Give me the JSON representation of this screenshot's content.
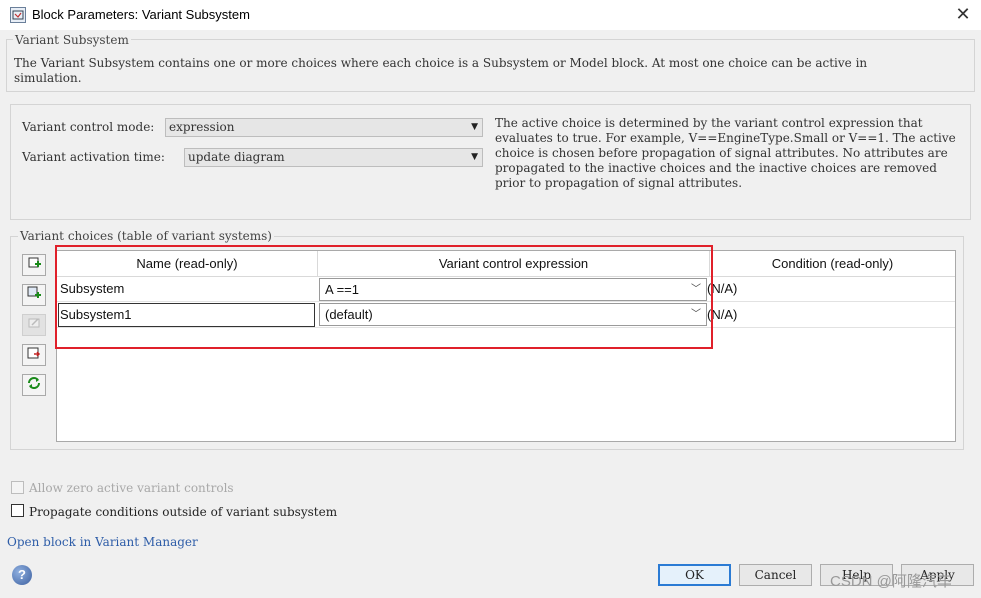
{
  "window": {
    "title": "Block Parameters: Variant Subsystem",
    "close_glyph": "✕"
  },
  "description_group": {
    "legend": "Variant Subsystem",
    "text": "The Variant Subsystem contains one or more choices where each choice is a Subsystem or Model block. At most one choice can be active in simulation."
  },
  "params_group": {
    "control_mode_label": "Variant control mode:",
    "control_mode_value": "expression",
    "activation_time_label": "Variant activation time:",
    "activation_time_value": "update diagram",
    "help_text": "The active choice is determined by the variant control expression that evaluates to true. For example, V==EngineType.Small or V==1. The active choice is chosen before propagation of signal attributes. No attributes are propagated to the inactive choices and the inactive choices are removed prior to propagation of signal attributes."
  },
  "choices_group": {
    "legend": "Variant choices (table of variant systems)",
    "side_buttons": [
      {
        "icon": "add-subsystem-icon"
      },
      {
        "icon": "add-model-icon"
      },
      {
        "icon": "edit-disabled-icon"
      },
      {
        "icon": "open-block-icon"
      },
      {
        "icon": "refresh-icon"
      }
    ],
    "columns": [
      "Name (read-only)",
      "Variant control expression",
      "Condition (read-only)"
    ],
    "rows": [
      {
        "name": "Subsystem",
        "expression": "A ==1",
        "condition": "(N/A)"
      },
      {
        "name": "Subsystem1",
        "expression": "(default)",
        "condition": "(N/A)"
      }
    ]
  },
  "options": {
    "allow_zero": "Allow zero active variant controls",
    "propagate": "Propagate conditions outside of variant subsystem"
  },
  "link": "Open block in Variant Manager",
  "buttons": {
    "ok": "OK",
    "cancel": "Cancel",
    "help": "Help",
    "apply": "Apply"
  },
  "watermark": "CSDN @阿隆汽车",
  "colors": {
    "highlight_box": "#e0202a",
    "link": "#2e5da8",
    "ok_border": "#2b7bd4"
  }
}
